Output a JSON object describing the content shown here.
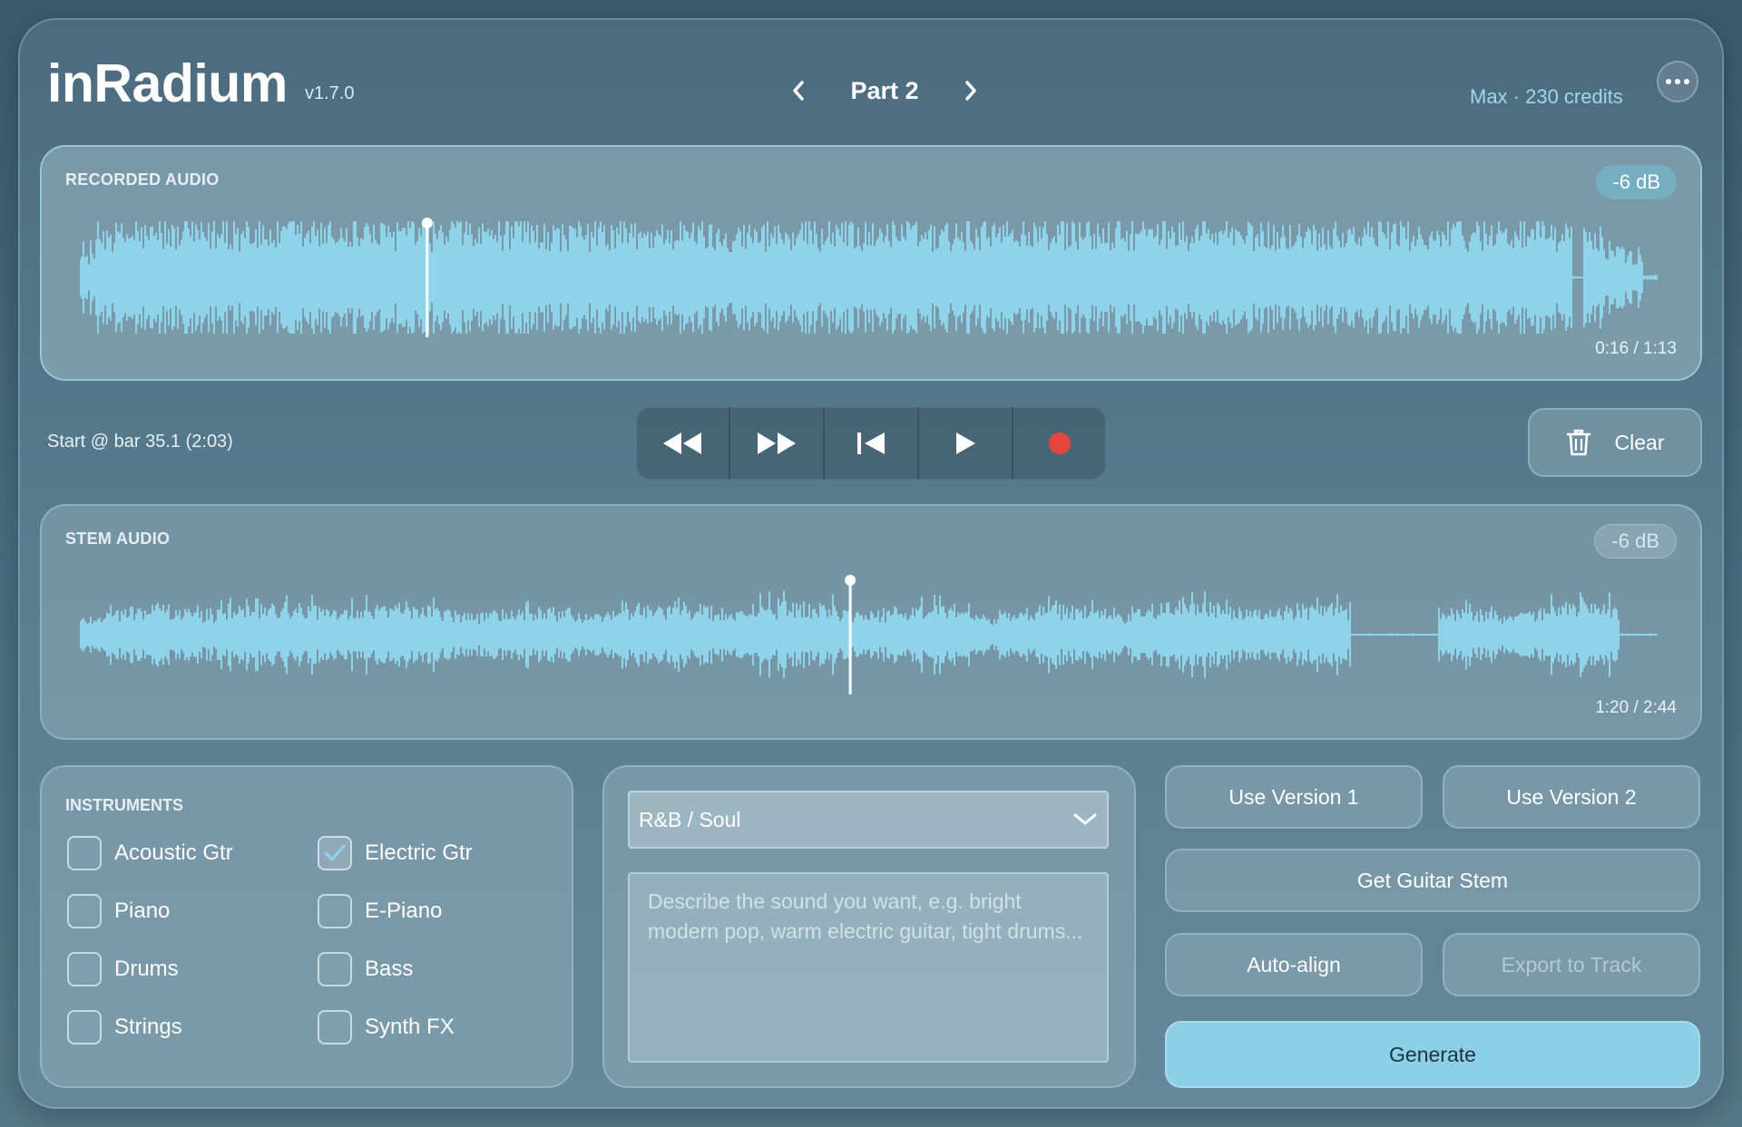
{
  "app": {
    "name": "inRadium",
    "version": "v1.7.0",
    "credits": "Max · 230 credits"
  },
  "nav": {
    "part": "Part 2"
  },
  "recorded": {
    "label": "RECORDED AUDIO",
    "gain": "-6 dB",
    "time": "0:16 / 1:13",
    "playhead_fraction": 0.22
  },
  "stem": {
    "label": "STEM AUDIO",
    "gain": "-6 dB",
    "time": "1:20 / 2:44",
    "playhead_fraction": 0.488
  },
  "transport": {
    "start_text": "Start @ bar 35.1  (2:03)",
    "clear_label": "Clear",
    "record_color": "#e5453f"
  },
  "instruments": {
    "label": "INSTRUMENTS",
    "items": [
      {
        "label": "Acoustic Gtr",
        "checked": false
      },
      {
        "label": "Electric Gtr",
        "checked": true
      },
      {
        "label": "Piano",
        "checked": false
      },
      {
        "label": "E-Piano",
        "checked": false
      },
      {
        "label": "Drums",
        "checked": false
      },
      {
        "label": "Bass",
        "checked": false
      },
      {
        "label": "Strings",
        "checked": false
      },
      {
        "label": "Synth FX",
        "checked": false
      }
    ]
  },
  "generator": {
    "genre": "R&B / Soul",
    "prompt_placeholder": "Describe the sound you want, e.g. bright modern pop, warm electric guitar, tight drums..."
  },
  "actions": {
    "use_v1": "Use Version 1",
    "use_v2": "Use Version 2",
    "guitar_stem": "Get Guitar Stem",
    "auto_align": "Auto-align",
    "export": "Export to Track",
    "generate": "Generate"
  },
  "colors": {
    "accent": "#8ccfe7",
    "waveform": "#8fd3ea"
  }
}
